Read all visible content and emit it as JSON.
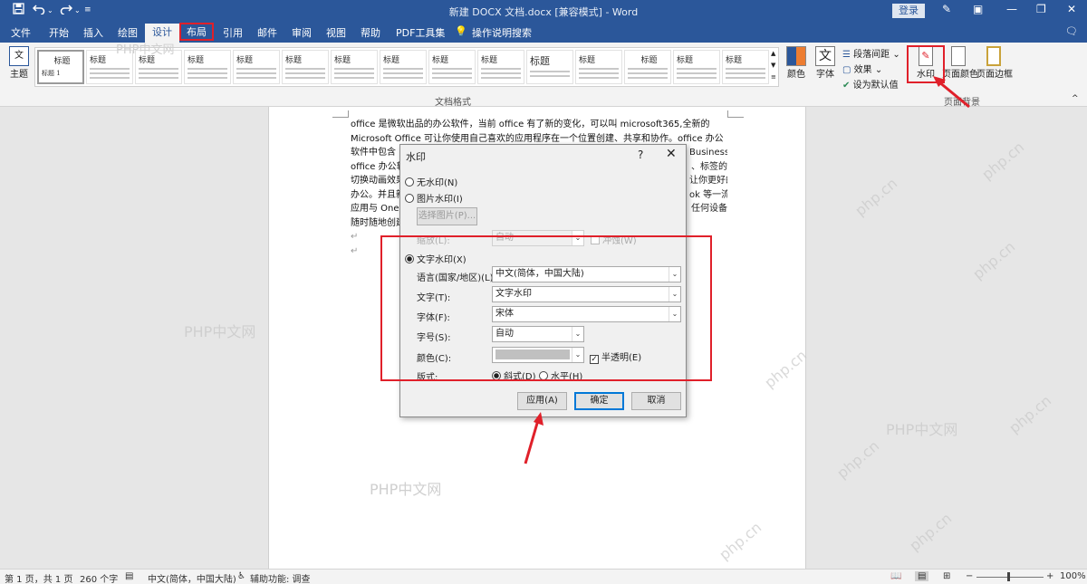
{
  "titlebar": {
    "title": "新建 DOCX 文档.docx [兼容模式]  -  Word",
    "login_label": "登录",
    "save_icon": "save-icon",
    "undo_icon": "undo-icon",
    "redo_icon": "redo-icon"
  },
  "tabs": [
    "文件",
    "开始",
    "插入",
    "绘图",
    "设计",
    "布局",
    "引用",
    "邮件",
    "审阅",
    "视图",
    "帮助",
    "PDF工具集",
    "操作说明搜索"
  ],
  "ribbon": {
    "theme_label": "主题",
    "theme_thumb_title": "标题",
    "theme_thumb_sub": "标题 1",
    "style_thumbs": [
      "标题",
      "标题",
      "标题",
      "标题",
      "标题",
      "标题",
      "标题",
      "标题",
      "标题",
      "标题",
      "标题",
      "标题",
      "标题",
      "标题"
    ],
    "group_doc_format": "文档格式",
    "colors_label": "颜色",
    "font_label": "字体",
    "font_icon_char": "文",
    "para_spacing_label": "段落间距",
    "effects_label": "效果",
    "set_default_label": "设为默认值",
    "watermark_label": "水印",
    "page_color_label": "页面颜色",
    "page_border_label": "页面边框",
    "group_page_bg": "页面背景"
  },
  "document": {
    "lines": [
      "office 是微软出品的办公软件，当前 office 有了新的变化，可以叫 microsoft365,全新的",
      "Microsoft Office 可让你使用自己喜欢的应用程序在一个位置创建、共享和协作。office 办公",
      "软件中包含",
      "office 办公软",
      "切换动画效果",
      "办公。并且新",
      "应用与 One",
      "随时随地创建"
    ],
    "right_frags": [
      "Business。",
      "、标签的",
      "让你更好的",
      "ok 等一流",
      "任何设备"
    ],
    "para_mark": "↵"
  },
  "watermarks": {
    "cn": "php.cn",
    "site": "PHP中文网"
  },
  "dialog": {
    "title": "水印",
    "help": "?",
    "close": "✕",
    "no_watermark": "无水印(N)",
    "picture_watermark": "图片水印(I)",
    "select_picture": "选择图片(P)...",
    "scale_label": "缩放(L):",
    "scale_value": "自动",
    "washout_label": "冲蚀(W)",
    "text_watermark": "文字水印(X)",
    "language_label": "语言(国家/地区)(L):",
    "language_value": "中文(简体，中国大陆)",
    "text_label": "文字(T):",
    "text_value": "文字水印",
    "font_label": "字体(F):",
    "font_value": "宋体",
    "size_label": "字号(S):",
    "size_value": "自动",
    "color_label": "颜色(C):",
    "semitransparent_label": "半透明(E)",
    "layout_label": "版式:",
    "diagonal_label": "斜式(D)",
    "horizontal_label": "水平(H)",
    "apply_button": "应用(A)",
    "ok_button": "确定",
    "cancel_button": "取消"
  },
  "statusbar": {
    "page_info": "第 1 页，共 1 页",
    "word_count": "260 个字",
    "language": "中文(简体，中国大陆)",
    "accessibility": "辅助功能: 调查",
    "zoom": "100%",
    "zoom_minus": "−",
    "zoom_plus": "+"
  },
  "colors": {
    "word_blue": "#2b579a",
    "highlight_red": "#e0202a"
  }
}
